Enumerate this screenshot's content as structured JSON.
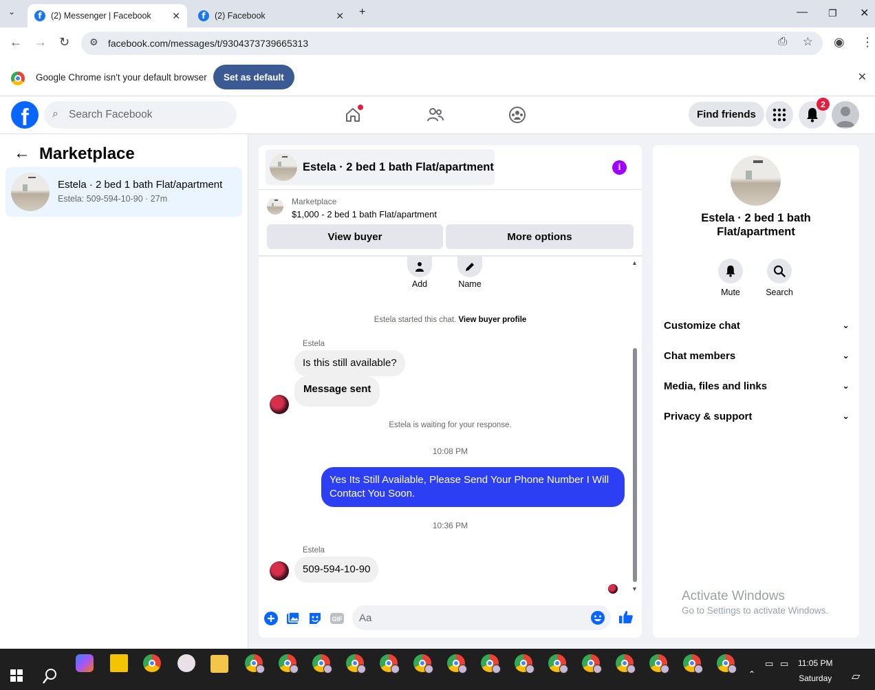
{
  "browser": {
    "tabs": [
      {
        "label": "(2) Messenger | Facebook",
        "active": true
      },
      {
        "label": "(2) Facebook",
        "active": false
      }
    ],
    "url": "facebook.com/messages/t/9304373739665313",
    "infobar": {
      "message": "Google Chrome isn't your default browser",
      "button": "Set as default"
    }
  },
  "fb": {
    "logo_letter": "f",
    "search_placeholder": "Search Facebook",
    "find_friends": "Find friends",
    "notification_count": "2"
  },
  "sidebar": {
    "title": "Marketplace",
    "conversation": {
      "title": "Estela · 2 bed 1 bath Flat/apartment",
      "subtitle": "Estela: 509-594-10-90 · 27m"
    }
  },
  "chat": {
    "header_title": "Estela · 2 bed 1 bath Flat/apartment",
    "listing_label": "Marketplace",
    "listing_detail": "$1,000 - 2 bed 1 bath Flat/apartment",
    "view_buyer": "View buyer",
    "more_options": "More options",
    "quick_actions": [
      "Add",
      "Name"
    ],
    "started_text": "Estela started this chat.",
    "view_buyer_profile": "View buyer profile",
    "messages": [
      {
        "sender": "Estela",
        "text": "Is this still available?"
      },
      {
        "text": "Message sent"
      }
    ],
    "waiting_text": "Estela is waiting for your response.",
    "time1": "10:08 PM",
    "outgoing": "Yes Its Still Available, Please Send Your Phone Number I Will Contact You Soon.",
    "time2": "10:36 PM",
    "reply_sender": "Estela",
    "reply_text": "509-594-10-90",
    "composer_placeholder": "Aa"
  },
  "details": {
    "title": "Estela · 2 bed 1 bath Flat/apartment",
    "actions": [
      "Mute",
      "Search"
    ],
    "sections": [
      "Customize chat",
      "Chat members",
      "Media, files and links",
      "Privacy & support"
    ],
    "watermark_title": "Activate Windows",
    "watermark_sub": "Go to Settings to activate Windows."
  },
  "taskbar": {
    "time": "11:05 PM",
    "day": "Saturday"
  },
  "colors": {
    "fb_blue": "#0866ff",
    "outgoing_bubble": "#2c3ff2",
    "info_purple": "#a100ff",
    "badge_red": "#e41e3f"
  }
}
